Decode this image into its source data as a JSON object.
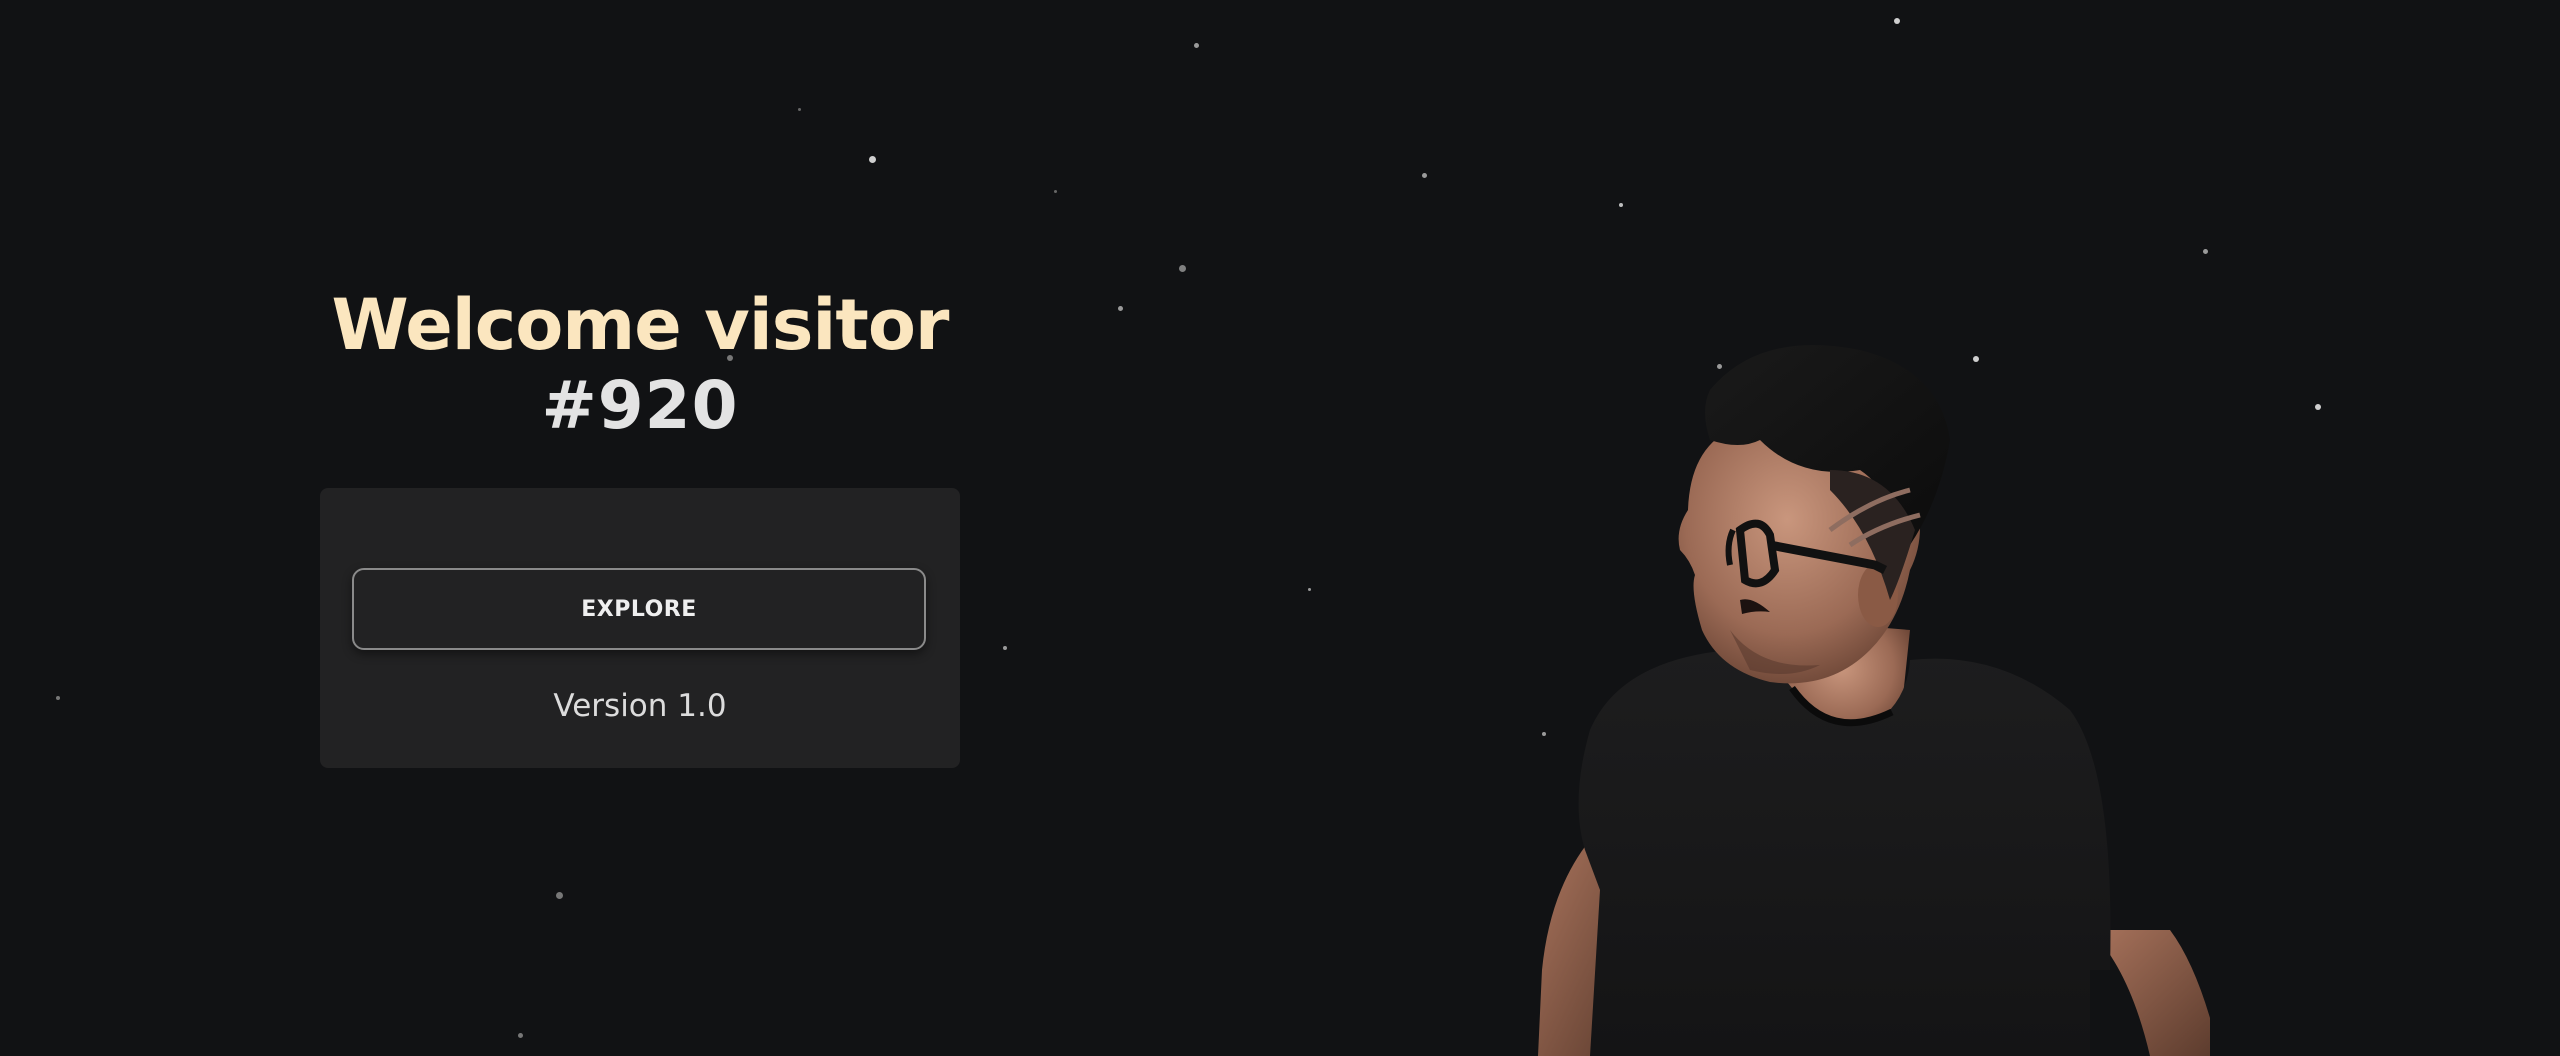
{
  "welcome": {
    "line1": "Welcome visitor",
    "line2": "#920"
  },
  "panel": {
    "explore_label": "EXPLORE",
    "version": "Version 1.0"
  },
  "colors": {
    "background": "#111214",
    "title_accent": "#fbe6bf",
    "panel": "#222223",
    "button_border": "#8a8a8a"
  },
  "avatar": {
    "icon": "3d-avatar"
  }
}
